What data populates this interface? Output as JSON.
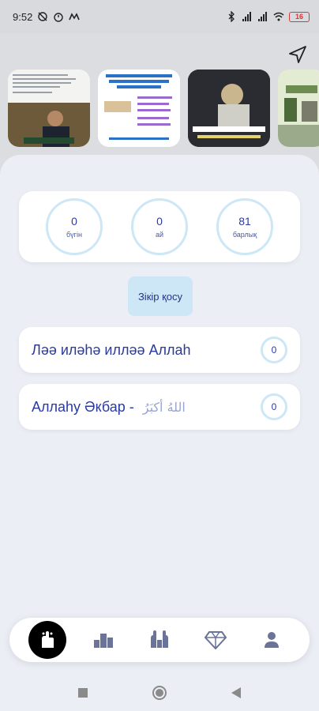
{
  "status": {
    "time": "9:52",
    "battery": "16"
  },
  "stories": [
    {
      "name": "story-1"
    },
    {
      "name": "story-2"
    },
    {
      "name": "story-3"
    },
    {
      "name": "story-4"
    }
  ],
  "counters": {
    "today": {
      "value": "0",
      "label": "бүгін"
    },
    "month": {
      "value": "0",
      "label": "ай"
    },
    "total": {
      "value": "81",
      "label": "барлық"
    }
  },
  "add_button_label": "Зікір қосу",
  "dhikrs": [
    {
      "text": "Ләә иләһә илләә  Аллаһ",
      "arabic": "",
      "count": "0"
    },
    {
      "text": "Аллаһу Әкбар - ",
      "arabic": "اللهُ أكبَرُ",
      "count": "0"
    }
  ],
  "nav": {
    "items": [
      "dhikr-hand-icon",
      "leaderboard-icon",
      "prayer-hands-icon",
      "diamond-icon",
      "profile-icon"
    ]
  },
  "colors": {
    "accent": "#2a3a9e",
    "ring": "#cde7f7",
    "panel": "#eceef6"
  }
}
